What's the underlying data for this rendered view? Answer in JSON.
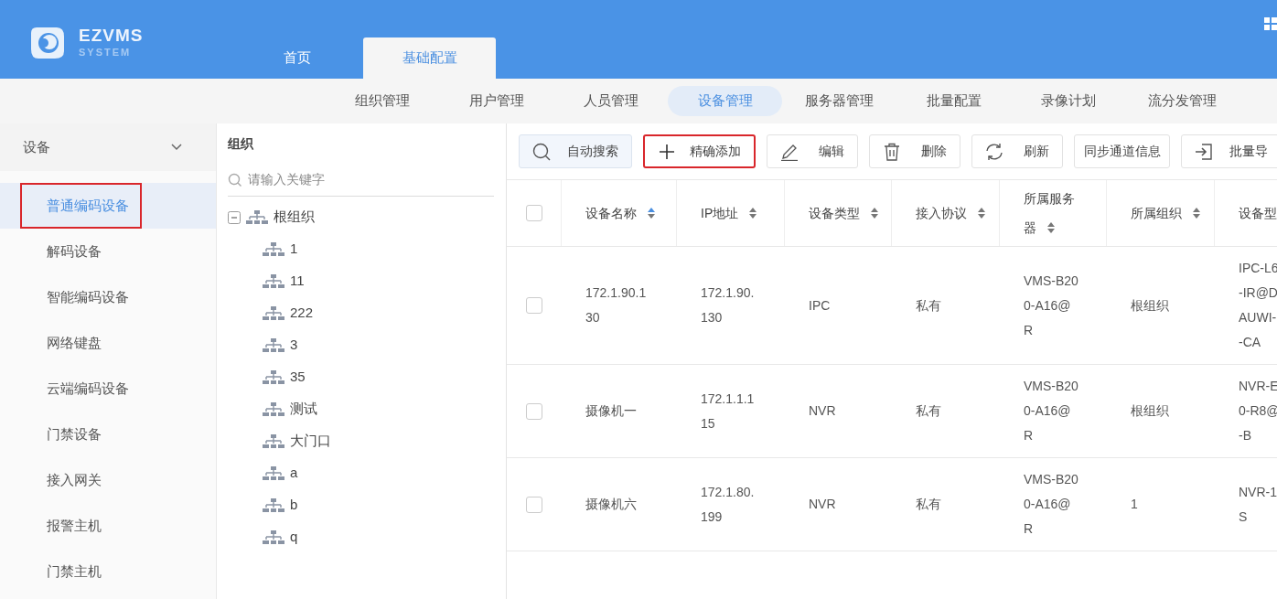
{
  "logo": {
    "name": "EZVMS",
    "subtitle": "SYSTEM"
  },
  "top_tabs": [
    {
      "label": "首页",
      "selected": false
    },
    {
      "label": "基础配置",
      "selected": true
    }
  ],
  "sub_nav": [
    {
      "label": "组织管理",
      "selected": false
    },
    {
      "label": "用户管理",
      "selected": false
    },
    {
      "label": "人员管理",
      "selected": false
    },
    {
      "label": "设备管理",
      "selected": true
    },
    {
      "label": "服务器管理",
      "selected": false
    },
    {
      "label": "批量配置",
      "selected": false
    },
    {
      "label": "录像计划",
      "selected": false
    },
    {
      "label": "流分发管理",
      "selected": false
    }
  ],
  "sidebar": {
    "title": "设备",
    "expanded": true,
    "items": [
      {
        "label": "普通编码设备",
        "selected": true,
        "highlighted": true
      },
      {
        "label": "解码设备",
        "selected": false,
        "highlighted": false
      },
      {
        "label": "智能编码设备",
        "selected": false,
        "highlighted": false
      },
      {
        "label": "网络键盘",
        "selected": false,
        "highlighted": false
      },
      {
        "label": "云端编码设备",
        "selected": false,
        "highlighted": false
      },
      {
        "label": "门禁设备",
        "selected": false,
        "highlighted": false
      },
      {
        "label": "接入网关",
        "selected": false,
        "highlighted": false
      },
      {
        "label": "报警主机",
        "selected": false,
        "highlighted": false
      },
      {
        "label": "门禁主机",
        "selected": false,
        "highlighted": false
      }
    ]
  },
  "tree": {
    "title": "组织",
    "search": {
      "placeholder": "请输入关键字"
    },
    "nodes": [
      {
        "label": "根组织",
        "expanded": true,
        "children": [
          {
            "label": "1"
          },
          {
            "label": "11"
          },
          {
            "label": "222"
          },
          {
            "label": "3"
          },
          {
            "label": "35"
          },
          {
            "label": "测试"
          },
          {
            "label": "大门口"
          },
          {
            "label": "a"
          },
          {
            "label": "b"
          },
          {
            "label": "q"
          }
        ]
      }
    ]
  },
  "toolbar": [
    {
      "label": "自动搜索",
      "kind": "search",
      "highlighted": false
    },
    {
      "label": "精确添加",
      "kind": "add",
      "highlighted": true
    },
    {
      "label": "编辑",
      "kind": "edit",
      "highlighted": false
    },
    {
      "label": "删除",
      "kind": "delete",
      "highlighted": false
    },
    {
      "label": "刷新",
      "kind": "refresh",
      "highlighted": false
    },
    {
      "label": "同步通道信息",
      "kind": "plain",
      "highlighted": false
    },
    {
      "label": "批量导",
      "kind": "import",
      "highlighted": false
    }
  ],
  "table": {
    "all_checked": false,
    "columns": [
      {
        "label": "设备名称",
        "sorted": true
      },
      {
        "label": "IP地址",
        "sorted": false
      },
      {
        "label": "设备类型",
        "sorted": false
      },
      {
        "label": "接入协议",
        "sorted": false
      },
      {
        "label": "所属服务器",
        "sorted": false
      },
      {
        "label": "所属组织",
        "sorted": false
      },
      {
        "label": "设备型"
      }
    ],
    "rows": [
      {
        "checked": false,
        "cells": [
          "172.1.90.130",
          "172.1.90.130",
          "IPC",
          "私有",
          "VMS-B200-A16@R",
          "根组织",
          "IPC-L6\n-IR@D\nAUWI-\n-CA"
        ]
      },
      {
        "checked": false,
        "cells": [
          "摄像机一",
          "172.1.1.115",
          "NVR",
          "私有",
          "VMS-B200-A16@R",
          "根组织",
          "NVR-E\n0-R8@\n-B"
        ]
      },
      {
        "checked": false,
        "cells": [
          "摄像机六",
          "172.1.80.199",
          "NVR",
          "私有",
          "VMS-B200-A16@R",
          "1",
          "NVR-1\nS"
        ]
      }
    ]
  }
}
